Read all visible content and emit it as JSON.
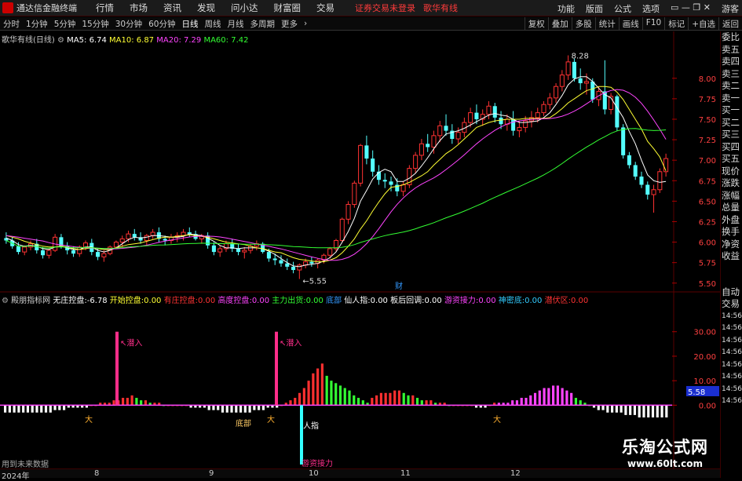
{
  "app": {
    "name": "通达信金融终端"
  },
  "menu": [
    "行情",
    "市场",
    "资讯",
    "发现",
    "问小达",
    "财富圈",
    "交易"
  ],
  "notice": {
    "text": "证券交易未登录",
    "stock": "歌华有线"
  },
  "titlebar_right": [
    "功能",
    "版面",
    "公式",
    "选项",
    "游客"
  ],
  "periods": [
    "分时",
    "1分钟",
    "5分钟",
    "15分钟",
    "30分钟",
    "60分钟",
    "日线",
    "周线",
    "月线",
    "多周期",
    "更多"
  ],
  "active_period": "日线",
  "toolbar_right": [
    "复权",
    "叠加",
    "多股",
    "统计",
    "画线",
    "F10",
    "标记",
    "+自选",
    "返回"
  ],
  "right_panel": [
    "委比",
    "卖五",
    "卖四",
    "卖三",
    "卖二",
    "卖一",
    "买一",
    "买二",
    "买三",
    "买四",
    "买五",
    "现价",
    "涨跌",
    "涨幅",
    "总量",
    "外盘",
    "换手",
    "净资",
    "收益"
  ],
  "right_panel_lower": [
    "自动",
    "交易"
  ],
  "price_legend": {
    "title": "歌华有线(日线)",
    "items": [
      {
        "name": "MA5",
        "value": "6.74",
        "color": "#ffffff"
      },
      {
        "name": "MA10",
        "value": "6.87",
        "color": "#ffff33"
      },
      {
        "name": "MA20",
        "value": "7.29",
        "color": "#ff44ff"
      },
      {
        "name": "MA60",
        "value": "7.42",
        "color": "#33ff33"
      }
    ]
  },
  "indicator_legend": {
    "title": "殿朋指标网",
    "items": [
      {
        "name": "无庄控盘",
        "value": "-6.78",
        "color": "#ffffff"
      },
      {
        "name": "开始控盘",
        "value": "0.00",
        "color": "#ffff33"
      },
      {
        "name": "有庄控盘",
        "value": "0.00",
        "color": "#ff3030"
      },
      {
        "name": "高度控盘",
        "value": "0.00",
        "color": "#ff44ff"
      },
      {
        "name": "主力出货",
        "value": "0.00",
        "color": "#33ff33"
      },
      {
        "name": "底部",
        "value": "",
        "color": "#3399ff"
      },
      {
        "name": "仙人指",
        "value": "0.00",
        "color": "#ffffff"
      },
      {
        "name": "板后回调",
        "value": "0.00",
        "color": "#ffffff"
      },
      {
        "name": "游资接力",
        "value": "0.00",
        "color": "#ff44ff"
      },
      {
        "name": "神密底",
        "value": "0.00",
        "color": "#33ccff"
      },
      {
        "name": "潜伏区",
        "value": "0.00",
        "color": "#ff3030"
      }
    ]
  },
  "price_axis": {
    "ticks": [
      "8.00",
      "7.75",
      "7.50",
      "7.25",
      "7.00",
      "6.75",
      "6.50",
      "6.25",
      "6.00",
      "5.75",
      "5.50"
    ],
    "min": 5.45,
    "max": 8.4
  },
  "indicator_axis": {
    "ticks": [
      "30.00",
      "20.00",
      "10.00",
      "0.00"
    ],
    "min": -5,
    "max": 36,
    "current": "5.58"
  },
  "annotations": {
    "high": "8.28",
    "low": "5.55",
    "cai": "财",
    "qianru": "潜入",
    "dibu": "底部",
    "renzhi": "人指",
    "youzi": "游资接力"
  },
  "date_labels": [
    "2024年",
    "8",
    "9",
    "10",
    "11",
    "12"
  ],
  "side_times": [
    "14:56",
    "14:56",
    "14:56",
    "14:56",
    "14:56",
    "14:56",
    "14:56",
    "14:56"
  ],
  "bottom_note": "用到未来数据",
  "watermark": {
    "main": "乐淘公式网",
    "url": "www.60lt.com"
  },
  "chart_data": [
    {
      "type": "candlestick",
      "title": "歌华有线(日线)",
      "ohlc": [
        [
          6.05,
          6.12,
          5.98,
          6.02
        ],
        [
          6.02,
          6.06,
          5.92,
          5.95
        ],
        [
          5.95,
          6.0,
          5.85,
          5.88
        ],
        [
          5.88,
          5.96,
          5.84,
          5.94
        ],
        [
          5.94,
          6.02,
          5.9,
          5.98
        ],
        [
          5.98,
          6.04,
          5.86,
          5.9
        ],
        [
          5.9,
          5.94,
          5.8,
          5.84
        ],
        [
          5.84,
          5.92,
          5.8,
          5.9
        ],
        [
          5.9,
          6.1,
          5.88,
          6.06
        ],
        [
          6.06,
          6.1,
          5.92,
          5.95
        ],
        [
          5.95,
          6.0,
          5.85,
          5.9
        ],
        [
          5.9,
          5.95,
          5.82,
          5.86
        ],
        [
          5.86,
          5.96,
          5.82,
          5.94
        ],
        [
          5.94,
          6.02,
          5.9,
          5.99
        ],
        [
          5.99,
          6.04,
          5.84,
          5.88
        ],
        [
          5.88,
          5.92,
          5.78,
          5.82
        ],
        [
          5.82,
          5.9,
          5.76,
          5.86
        ],
        [
          5.86,
          5.96,
          5.84,
          5.94
        ],
        [
          5.94,
          6.02,
          5.92,
          6.0
        ],
        [
          6.0,
          6.08,
          5.94,
          6.04
        ],
        [
          6.04,
          6.14,
          6.0,
          6.1
        ],
        [
          6.1,
          6.16,
          6.02,
          6.06
        ],
        [
          6.06,
          6.12,
          5.98,
          6.02
        ],
        [
          6.02,
          6.1,
          5.96,
          6.08
        ],
        [
          6.08,
          6.16,
          6.04,
          6.12
        ],
        [
          6.12,
          6.18,
          6.0,
          6.04
        ],
        [
          6.04,
          6.08,
          5.96,
          6.02
        ],
        [
          6.02,
          6.1,
          5.98,
          6.06
        ],
        [
          6.06,
          6.12,
          6.0,
          6.08
        ],
        [
          6.08,
          6.16,
          6.02,
          6.12
        ],
        [
          6.12,
          6.18,
          6.06,
          6.1
        ],
        [
          6.1,
          6.14,
          6.02,
          6.04
        ],
        [
          6.04,
          6.1,
          5.98,
          6.08
        ],
        [
          6.08,
          6.12,
          5.92,
          5.96
        ],
        [
          5.96,
          6.0,
          5.84,
          5.88
        ],
        [
          5.88,
          5.96,
          5.82,
          5.92
        ],
        [
          5.92,
          6.02,
          5.88,
          5.98
        ],
        [
          5.98,
          6.04,
          5.88,
          5.92
        ],
        [
          5.92,
          5.98,
          5.84,
          5.88
        ],
        [
          5.88,
          5.94,
          5.8,
          5.9
        ],
        [
          5.9,
          5.98,
          5.86,
          5.95
        ],
        [
          5.95,
          6.02,
          5.9,
          5.98
        ],
        [
          5.98,
          6.0,
          5.86,
          5.88
        ],
        [
          5.88,
          5.92,
          5.76,
          5.8
        ],
        [
          5.8,
          5.86,
          5.72,
          5.78
        ],
        [
          5.78,
          5.84,
          5.7,
          5.74
        ],
        [
          5.74,
          5.8,
          5.66,
          5.7
        ],
        [
          5.7,
          5.76,
          5.62,
          5.66
        ],
        [
          5.66,
          5.74,
          5.55,
          5.72
        ],
        [
          5.72,
          5.8,
          5.68,
          5.76
        ],
        [
          5.76,
          5.82,
          5.7,
          5.74
        ],
        [
          5.74,
          5.8,
          5.68,
          5.78
        ],
        [
          5.78,
          5.86,
          5.74,
          5.84
        ],
        [
          5.84,
          5.94,
          5.8,
          5.92
        ],
        [
          5.92,
          6.04,
          5.88,
          6.02
        ],
        [
          6.02,
          6.3,
          6.0,
          6.28
        ],
        [
          6.28,
          6.5,
          6.22,
          6.46
        ],
        [
          6.46,
          6.75,
          6.42,
          6.72
        ],
        [
          6.72,
          7.2,
          6.68,
          7.18
        ],
        [
          7.18,
          7.3,
          6.95,
          7.02
        ],
        [
          7.02,
          7.12,
          6.8,
          6.86
        ],
        [
          6.86,
          6.94,
          6.7,
          6.76
        ],
        [
          6.76,
          6.84,
          6.66,
          6.74
        ],
        [
          6.74,
          6.8,
          6.62,
          6.7
        ],
        [
          6.7,
          6.78,
          6.56,
          6.62
        ],
        [
          6.62,
          6.74,
          6.56,
          6.7
        ],
        [
          6.7,
          6.94,
          6.66,
          6.9
        ],
        [
          6.9,
          7.1,
          6.84,
          7.06
        ],
        [
          7.06,
          7.26,
          7.0,
          7.2
        ],
        [
          7.2,
          7.32,
          7.1,
          7.16
        ],
        [
          7.16,
          7.36,
          7.08,
          7.3
        ],
        [
          7.3,
          7.48,
          7.22,
          7.42
        ],
        [
          7.42,
          7.56,
          7.3,
          7.36
        ],
        [
          7.36,
          7.44,
          7.2,
          7.26
        ],
        [
          7.26,
          7.4,
          7.2,
          7.34
        ],
        [
          7.34,
          7.52,
          7.28,
          7.46
        ],
        [
          7.46,
          7.64,
          7.4,
          7.58
        ],
        [
          7.58,
          7.68,
          7.44,
          7.5
        ],
        [
          7.5,
          7.62,
          7.42,
          7.56
        ],
        [
          7.56,
          7.72,
          7.5,
          7.66
        ],
        [
          7.66,
          7.7,
          7.46,
          7.52
        ],
        [
          7.52,
          7.6,
          7.38,
          7.44
        ],
        [
          7.44,
          7.56,
          7.36,
          7.5
        ],
        [
          7.5,
          7.6,
          7.3,
          7.36
        ],
        [
          7.36,
          7.48,
          7.28,
          7.4
        ],
        [
          7.4,
          7.54,
          7.34,
          7.48
        ],
        [
          7.48,
          7.6,
          7.4,
          7.52
        ],
        [
          7.52,
          7.64,
          7.46,
          7.58
        ],
        [
          7.58,
          7.72,
          7.54,
          7.68
        ],
        [
          7.68,
          7.82,
          7.62,
          7.76
        ],
        [
          7.76,
          7.94,
          7.7,
          7.9
        ],
        [
          7.9,
          8.1,
          7.84,
          8.04
        ],
        [
          8.04,
          8.28,
          7.98,
          8.2
        ],
        [
          8.2,
          8.24,
          7.96,
          8.0
        ],
        [
          8.0,
          8.12,
          7.86,
          7.94
        ],
        [
          7.94,
          8.06,
          7.8,
          7.96
        ],
        [
          7.96,
          8.0,
          7.7,
          7.74
        ],
        [
          7.74,
          7.9,
          7.66,
          7.84
        ],
        [
          7.84,
          8.22,
          7.56,
          7.62
        ],
        [
          7.62,
          7.82,
          7.56,
          7.78
        ],
        [
          7.78,
          7.8,
          7.36,
          7.4
        ],
        [
          7.4,
          7.44,
          7.02,
          7.06
        ],
        [
          7.06,
          7.1,
          6.9,
          6.94
        ],
        [
          6.94,
          6.98,
          6.76,
          6.8
        ],
        [
          6.8,
          6.86,
          6.66,
          6.7
        ],
        [
          6.7,
          6.74,
          6.52,
          6.58
        ],
        [
          6.58,
          6.7,
          6.36,
          6.64
        ],
        [
          6.64,
          6.9,
          6.6,
          6.86
        ],
        [
          6.86,
          7.08,
          6.8,
          7.02
        ]
      ],
      "ma5": [
        6.05,
        6.02,
        5.97,
        5.95,
        5.96,
        5.95,
        5.92,
        5.91,
        5.94,
        5.95,
        5.93,
        5.91,
        5.91,
        5.94,
        5.94,
        5.9,
        5.88,
        5.9,
        5.93,
        5.98,
        6.03,
        6.06,
        6.05,
        6.06,
        6.08,
        6.08,
        6.07,
        6.06,
        6.06,
        6.07,
        6.1,
        6.09,
        6.08,
        6.05,
        6.01,
        5.96,
        5.93,
        5.93,
        5.92,
        5.93,
        5.93,
        5.93,
        5.92,
        5.89,
        5.85,
        5.8,
        5.75,
        5.71,
        5.7,
        5.72,
        5.73,
        5.74,
        5.77,
        5.81,
        5.88,
        6.0,
        6.13,
        6.29,
        6.5,
        6.63,
        6.77,
        6.85,
        6.89,
        6.86,
        6.74,
        6.74,
        6.78,
        6.84,
        6.93,
        7.03,
        7.14,
        7.24,
        7.32,
        7.34,
        7.36,
        7.39,
        7.43,
        7.47,
        7.51,
        7.55,
        7.57,
        7.55,
        7.54,
        7.5,
        7.46,
        7.46,
        7.47,
        7.48,
        7.52,
        7.58,
        7.68,
        7.79,
        7.92,
        7.99,
        8.02,
        8.02,
        7.96,
        7.88,
        7.8,
        7.76,
        7.64,
        7.52,
        7.35,
        7.2,
        7.0,
        6.82,
        6.75,
        6.73,
        6.74
      ],
      "ma10": [
        6.08,
        6.06,
        6.04,
        6.01,
        5.99,
        5.97,
        5.95,
        5.94,
        5.94,
        5.95,
        5.94,
        5.92,
        5.91,
        5.92,
        5.93,
        5.92,
        5.91,
        5.91,
        5.93,
        5.95,
        5.97,
        5.98,
        5.99,
        6.01,
        6.03,
        6.05,
        6.06,
        6.06,
        6.07,
        6.08,
        6.09,
        6.08,
        6.07,
        6.06,
        6.04,
        6.02,
        6.0,
        5.99,
        5.98,
        5.97,
        5.95,
        5.93,
        5.92,
        5.9,
        5.88,
        5.87,
        5.84,
        5.81,
        5.79,
        5.78,
        5.77,
        5.76,
        5.76,
        5.78,
        5.81,
        5.87,
        5.95,
        6.04,
        6.16,
        6.26,
        6.38,
        6.49,
        6.59,
        6.67,
        6.68,
        6.7,
        6.73,
        6.77,
        6.81,
        6.86,
        6.94,
        7.01,
        7.08,
        7.13,
        7.19,
        7.26,
        7.33,
        7.4,
        7.43,
        7.46,
        7.48,
        7.49,
        7.5,
        7.5,
        7.5,
        7.51,
        7.51,
        7.51,
        7.51,
        7.52,
        7.57,
        7.63,
        7.7,
        7.75,
        7.8,
        7.85,
        7.87,
        7.9,
        7.9,
        7.89,
        7.83,
        7.74,
        7.62,
        7.5,
        7.38,
        7.23,
        7.14,
        7.04,
        6.87
      ]
    },
    {
      "type": "bar",
      "title": "殿朋指标网",
      "bar_values": [
        -3,
        -3,
        -3,
        -3,
        -3,
        -3,
        -3,
        -3,
        -3,
        -3,
        -3,
        -2,
        -2,
        -2,
        -1,
        -1,
        -1,
        -1,
        -1,
        0,
        0,
        1,
        1,
        1,
        2,
        2,
        3,
        3,
        4,
        3,
        2,
        2,
        1,
        1,
        1,
        0,
        0,
        0,
        0,
        0,
        0,
        -1,
        -1,
        -1,
        -1,
        -2,
        -2,
        -2,
        -3,
        -3,
        -3,
        -3,
        -3,
        -3,
        -3,
        -2,
        -2,
        -2,
        -1,
        -1,
        -1,
        0,
        1,
        2,
        3,
        5,
        7,
        10,
        13,
        15,
        17,
        12,
        10,
        9,
        8,
        7,
        6,
        4,
        3,
        2,
        1,
        3,
        4,
        5,
        5,
        5,
        6,
        6,
        5,
        4,
        4,
        3,
        2,
        2,
        2,
        1,
        1,
        1,
        0,
        0,
        0,
        0,
        0,
        0,
        -1,
        -1,
        -1,
        0,
        1,
        1,
        1,
        1,
        2,
        2,
        3,
        3,
        4,
        5,
        6,
        7,
        7,
        8,
        8,
        7,
        6,
        5,
        3,
        2,
        1,
        0,
        -1,
        -2,
        -2,
        -3,
        -3,
        -3,
        -3,
        -4,
        -4,
        -4,
        -5,
        -5,
        -5,
        -5,
        -5,
        -5,
        -5
      ],
      "bar_colors": "positive bars red then green when falling, pink in late Dec, white negatives",
      "spikes": [
        {
          "label": "潜入",
          "value": 30
        },
        {
          "label": "潜入",
          "value": 30
        }
      ],
      "latest": "5.58"
    }
  ]
}
